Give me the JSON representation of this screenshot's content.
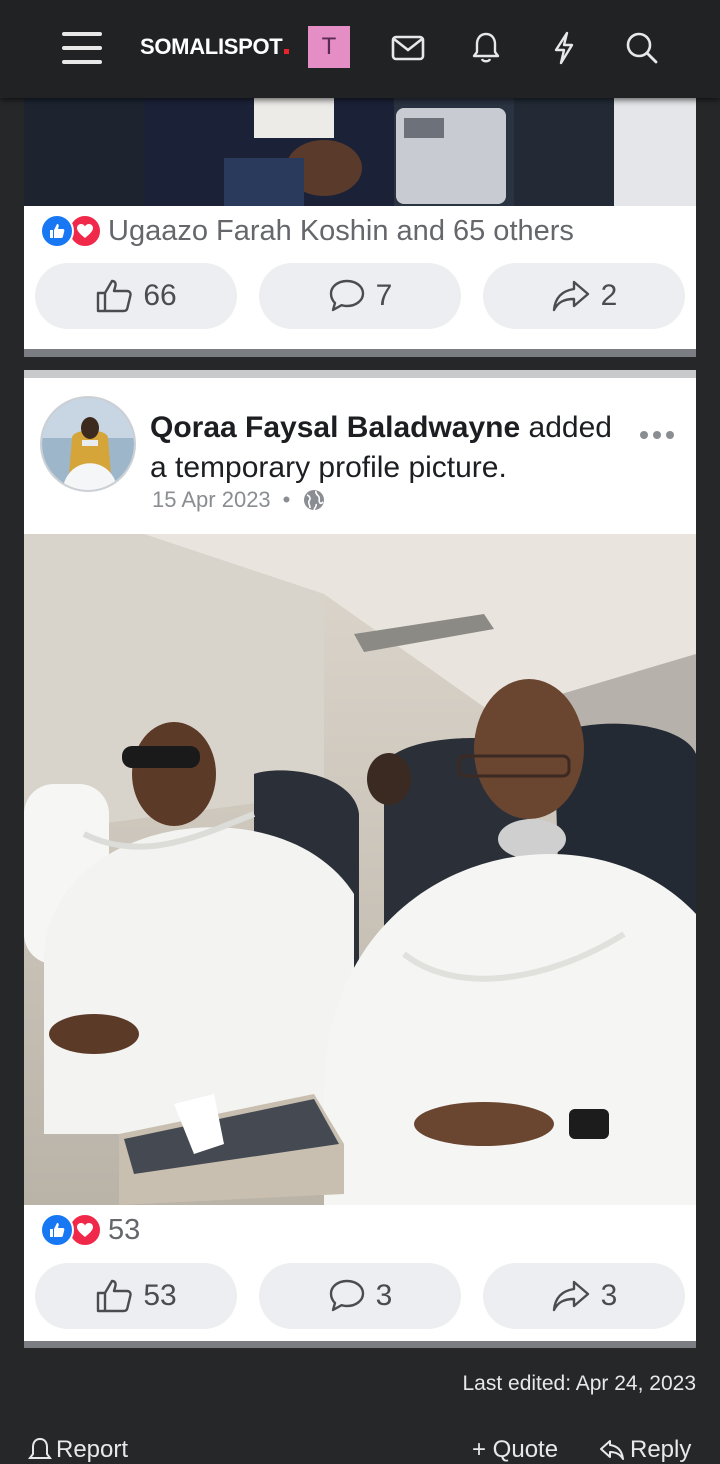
{
  "nav": {
    "logo_text": "SOMALISPOT",
    "user_initial": "T",
    "icons": [
      "menu-icon",
      "mail-icon",
      "bell-icon",
      "lightning-icon",
      "search-icon"
    ]
  },
  "post1": {
    "reaction_summary": "Ugaazo Farah Koshin and 65 others",
    "likes": "66",
    "comments": "7",
    "shares": "2"
  },
  "post2": {
    "author": "Qoraa Faysal Baladwayne",
    "action_text": "added a temporary profile picture.",
    "date": "15 Apr 2023",
    "separator": "•",
    "reaction_count": "53",
    "likes": "53",
    "comments": "3",
    "shares": "3"
  },
  "footer": {
    "last_edited": "Last edited: Apr 24, 2023",
    "report_label": "Report",
    "quote_label": "+ Quote",
    "reply_label": "Reply"
  },
  "colors": {
    "like_blue": "#1877f2",
    "love_red": "#f0284a",
    "nav_bg": "#202224",
    "page_bg": "#252729"
  }
}
